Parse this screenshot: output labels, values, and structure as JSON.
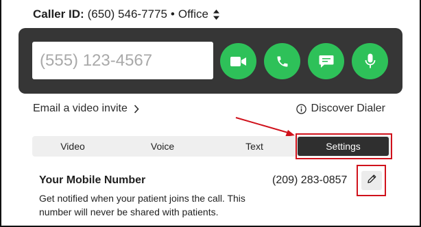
{
  "caller_id": {
    "label": "Caller ID:",
    "number": "(650) 546-7775",
    "separator": "•",
    "line_name": "Office"
  },
  "dialer": {
    "placeholder": "(555) 123-4567",
    "buttons": [
      {
        "name": "video-call-button",
        "icon": "video-camera-icon"
      },
      {
        "name": "voice-call-button",
        "icon": "phone-icon"
      },
      {
        "name": "message-button",
        "icon": "chat-bubble-icon"
      },
      {
        "name": "microphone-button",
        "icon": "microphone-icon"
      }
    ],
    "accent_color": "#2ec159"
  },
  "links": {
    "email_invite": "Email a video invite",
    "discover": "Discover Dialer"
  },
  "tabs": [
    {
      "label": "Video"
    },
    {
      "label": "Voice"
    },
    {
      "label": "Text"
    },
    {
      "label": "Settings",
      "selected": true
    }
  ],
  "mobile": {
    "title": "Your Mobile Number",
    "number": "(209) 283-0857",
    "description": "Get notified when your patient joins the call. This number will never be shared with patients."
  },
  "annotation_color": "#d0111b"
}
